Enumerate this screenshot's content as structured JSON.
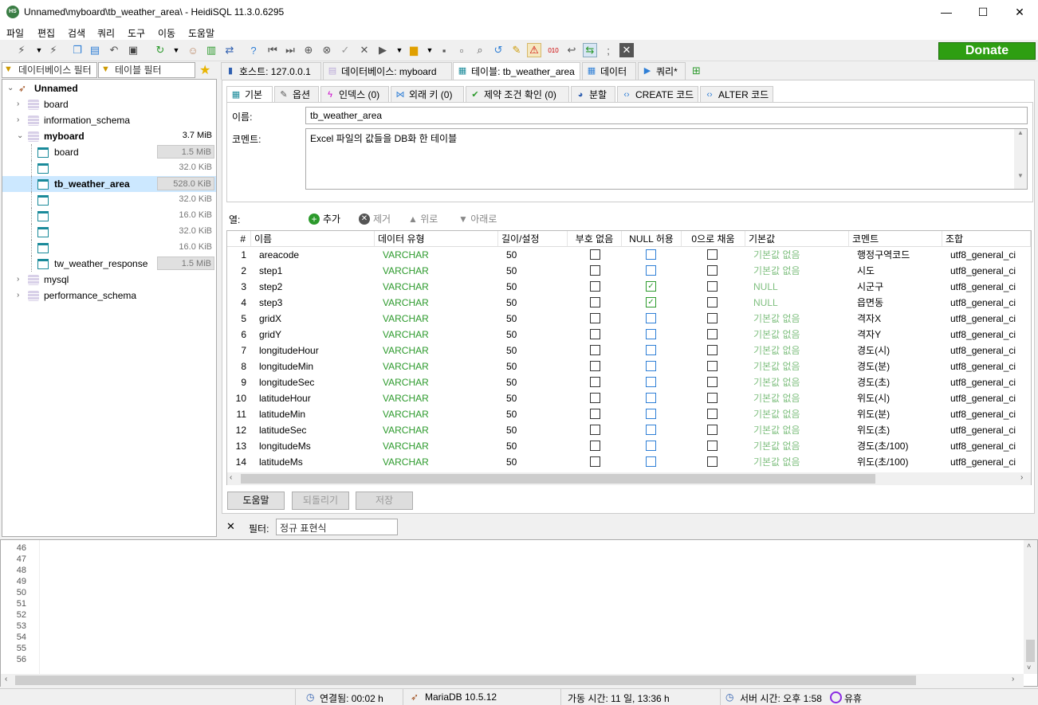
{
  "window": {
    "title": "Unnamed\\myboard\\tb_weather_area\\ - HeidiSQL 11.3.0.6295",
    "icon_text": "HS",
    "min": "—",
    "max": "☐",
    "close": "✕"
  },
  "menu": [
    "파일",
    "편집",
    "검색",
    "쿼리",
    "도구",
    "이동",
    "도움말"
  ],
  "donate": "Donate",
  "filters": {
    "db_placeholder": "데이터베이스 필터",
    "table_placeholder": "테이블 필터"
  },
  "tree": {
    "root": "Unnamed",
    "items": [
      {
        "label": "board",
        "size": "",
        "level": 1,
        "type": "db"
      },
      {
        "label": "information_schema",
        "size": "",
        "level": 1,
        "type": "db"
      },
      {
        "label": "myboard",
        "size": "3.7 MiB",
        "level": 1,
        "type": "db",
        "bold": true
      },
      {
        "label": "board",
        "size": "1.5 MiB",
        "level": 2,
        "type": "table",
        "bar": true
      },
      {
        "label": "",
        "size": "32.0 KiB",
        "level": 2,
        "type": "table"
      },
      {
        "label": "tb_weather_area",
        "size": "528.0 KiB",
        "level": 2,
        "type": "table",
        "bold": true,
        "selected": true,
        "bar": true
      },
      {
        "label": "",
        "size": "32.0 KiB",
        "level": 2,
        "type": "table"
      },
      {
        "label": "",
        "size": "16.0 KiB",
        "level": 2,
        "type": "table"
      },
      {
        "label": "",
        "size": "32.0 KiB",
        "level": 2,
        "type": "table"
      },
      {
        "label": "",
        "size": "16.0 KiB",
        "level": 2,
        "type": "table"
      },
      {
        "label": "tw_weather_response",
        "size": "1.5 MiB",
        "level": 2,
        "type": "table",
        "bar": true
      },
      {
        "label": "mysql",
        "size": "",
        "level": 1,
        "type": "db"
      },
      {
        "label": "performance_schema",
        "size": "",
        "level": 1,
        "type": "db"
      }
    ]
  },
  "top_tabs": [
    "호스트: 127.0.0.1",
    "데이터베이스: myboard",
    "테이블: tb_weather_area",
    "데이터",
    "쿼리*"
  ],
  "sub_tabs": [
    "기본",
    "옵션",
    "인덱스 (0)",
    "외래 키 (0)",
    "제약 조건 확인 (0)",
    "분할",
    "CREATE 코드",
    "ALTER 코드"
  ],
  "form": {
    "name_label": "이름:",
    "name_value": "tb_weather_area",
    "comment_label": "코멘트:",
    "comment_value": "Excel 파일의 값들을 DB화 한 테이블"
  },
  "columns_bar": {
    "label": "열:",
    "add": "추가",
    "remove": "제거",
    "up": "위로",
    "down": "아래로"
  },
  "grid_headers": [
    "#",
    "이름",
    "데이터 유형",
    "길이/설정",
    "부호 없음",
    "NULL 허용",
    "0으로 채움",
    "기본값",
    "코멘트",
    "조합"
  ],
  "rows": [
    {
      "n": "1",
      "name": "areacode",
      "type": "VARCHAR",
      "len": "50",
      "null": false,
      "def": "기본값 없음",
      "comment": "행정구역코드",
      "coll": "utf8_general_ci"
    },
    {
      "n": "2",
      "name": "step1",
      "type": "VARCHAR",
      "len": "50",
      "null": false,
      "def": "기본값 없음",
      "comment": "시도",
      "coll": "utf8_general_ci"
    },
    {
      "n": "3",
      "name": "step2",
      "type": "VARCHAR",
      "len": "50",
      "null": true,
      "def": "NULL",
      "comment": "시군구",
      "coll": "utf8_general_ci"
    },
    {
      "n": "4",
      "name": "step3",
      "type": "VARCHAR",
      "len": "50",
      "null": true,
      "def": "NULL",
      "comment": "읍면동",
      "coll": "utf8_general_ci"
    },
    {
      "n": "5",
      "name": "gridX",
      "type": "VARCHAR",
      "len": "50",
      "null": false,
      "def": "기본값 없음",
      "comment": "격자X",
      "coll": "utf8_general_ci"
    },
    {
      "n": "6",
      "name": "gridY",
      "type": "VARCHAR",
      "len": "50",
      "null": false,
      "def": "기본값 없음",
      "comment": "격자Y",
      "coll": "utf8_general_ci"
    },
    {
      "n": "7",
      "name": "longitudeHour",
      "type": "VARCHAR",
      "len": "50",
      "null": false,
      "def": "기본값 없음",
      "comment": "경도(시)",
      "coll": "utf8_general_ci"
    },
    {
      "n": "8",
      "name": "longitudeMin",
      "type": "VARCHAR",
      "len": "50",
      "null": false,
      "def": "기본값 없음",
      "comment": "경도(분)",
      "coll": "utf8_general_ci"
    },
    {
      "n": "9",
      "name": "longitudeSec",
      "type": "VARCHAR",
      "len": "50",
      "null": false,
      "def": "기본값 없음",
      "comment": "경도(초)",
      "coll": "utf8_general_ci"
    },
    {
      "n": "10",
      "name": "latitudeHour",
      "type": "VARCHAR",
      "len": "50",
      "null": false,
      "def": "기본값 없음",
      "comment": "위도(시)",
      "coll": "utf8_general_ci"
    },
    {
      "n": "11",
      "name": "latitudeMin",
      "type": "VARCHAR",
      "len": "50",
      "null": false,
      "def": "기본값 없음",
      "comment": "위도(분)",
      "coll": "utf8_general_ci"
    },
    {
      "n": "12",
      "name": "latitudeSec",
      "type": "VARCHAR",
      "len": "50",
      "null": false,
      "def": "기본값 없음",
      "comment": "위도(초)",
      "coll": "utf8_general_ci"
    },
    {
      "n": "13",
      "name": "longitudeMs",
      "type": "VARCHAR",
      "len": "50",
      "null": false,
      "def": "기본값 없음",
      "comment": "경도(초/100)",
      "coll": "utf8_general_ci"
    },
    {
      "n": "14",
      "name": "latitudeMs",
      "type": "VARCHAR",
      "len": "50",
      "null": false,
      "def": "기본값 없음",
      "comment": "위도(초/100)",
      "coll": "utf8_general_ci"
    }
  ],
  "buttons": {
    "help": "도움말",
    "revert": "되돌리기",
    "save": "저장"
  },
  "filter_bar": {
    "label": "필터:",
    "placeholder": "정규 표현식"
  },
  "editor_lines": [
    "46",
    "47",
    "48",
    "49",
    "50",
    "51",
    "52",
    "53",
    "54",
    "55",
    "56"
  ],
  "status": {
    "connected": "연결됨: 00:02 h",
    "server": "MariaDB 10.5.12",
    "uptime": "가동 시간: 11 일, 13:36 h",
    "server_time": "서버 시간: 오후 1:58",
    "idle": "유휴"
  },
  "colors": {
    "donate": "#2e9e12",
    "green_text": "#2c9a2c",
    "checkbox_blue": "#2f7fd6",
    "selection": "#cce8ff"
  }
}
